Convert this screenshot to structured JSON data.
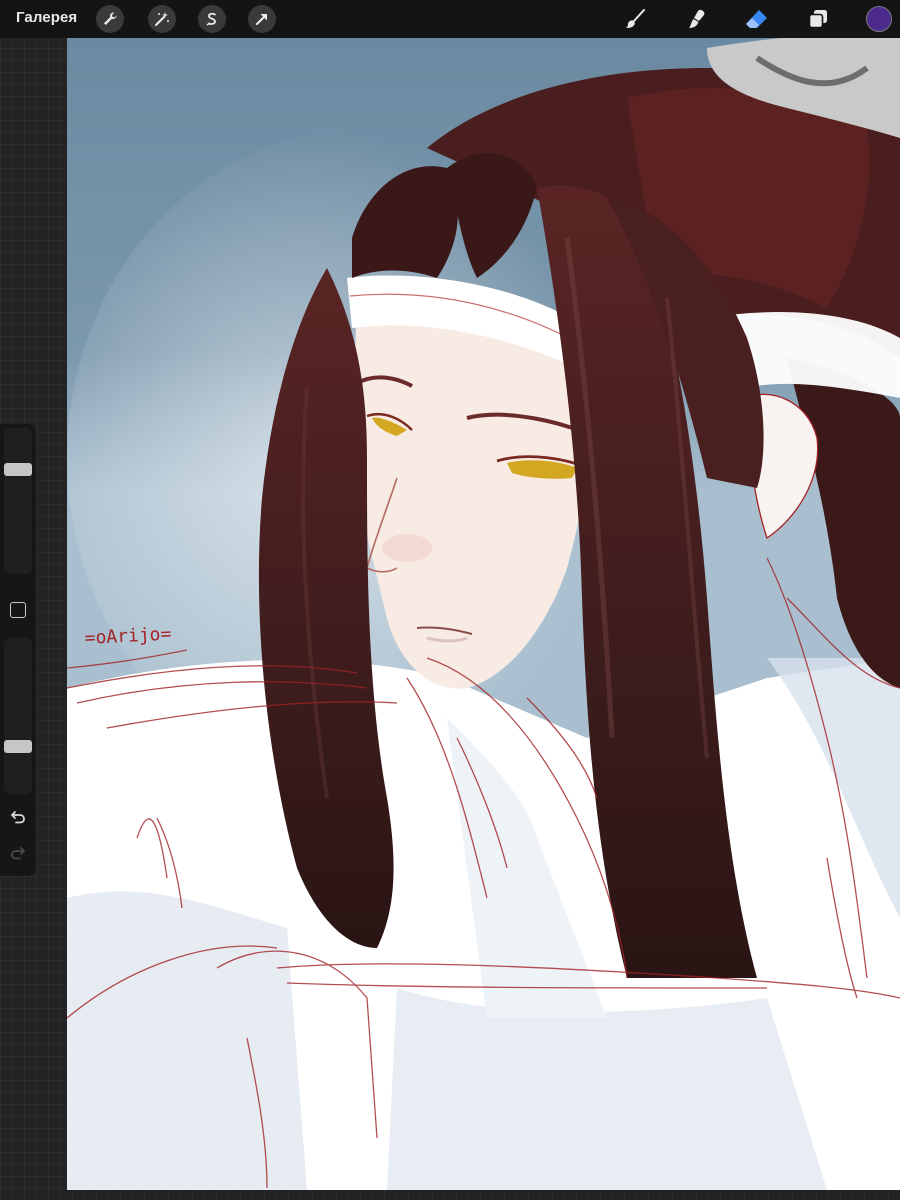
{
  "toolbar": {
    "gallery_label": "Галерея",
    "left_tools": [
      "wrench-icon",
      "magic-wand-icon",
      "selection-icon",
      "transform-arrow-icon"
    ],
    "right_tools": [
      "brush-icon",
      "smudge-icon",
      "eraser-icon",
      "layers-icon"
    ],
    "active_tool": "eraser",
    "active_color": "#4b2a8c",
    "eraser_accent": "#3b86f5"
  },
  "sidebar": {
    "items": [
      "brush-size-slider",
      "modify-button",
      "opacity-slider",
      "undo-button",
      "redo-button"
    ],
    "brush_size_level": 0.26,
    "opacity_level": 0.71
  },
  "canvas": {
    "signature": "=oArijo=",
    "colors": {
      "background_blue": "#6e8da3",
      "hair_dark": "#3e1d1d",
      "sketch_red": "#a22226",
      "skin": "#f5e8e0",
      "eyes": "#d4a722",
      "robe": "#e4ecf2"
    }
  }
}
